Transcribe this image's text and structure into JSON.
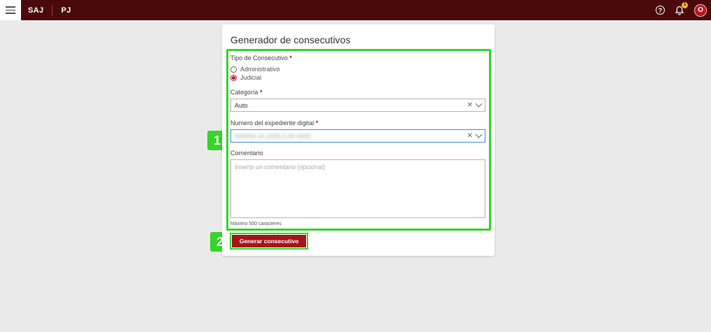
{
  "topbar": {
    "brand_primary": "SAJ",
    "brand_secondary": "PJ",
    "help_icon_glyph": "?",
    "notification_count": "1",
    "avatar_initial": "O"
  },
  "form": {
    "title": "Generador de consecutivos",
    "tipo": {
      "label": "Tipo de Consecutivo",
      "options": [
        "Administrativo",
        "Judicial"
      ],
      "selected": "Judicial"
    },
    "categoria": {
      "label": "Categoría",
      "value": "Auto"
    },
    "expediente": {
      "label": "Numero del expediente digital",
      "value": "000000-15.2025.0.00.0003"
    },
    "comentario": {
      "label": "Comentario",
      "placeholder": "Inserte un comentario (opcional)",
      "helper": "Máximo 500 caracteres"
    },
    "required_mark": "*",
    "submit_label": "Generar consecutivo"
  },
  "annotations": {
    "step1": "1",
    "step2": "2",
    "highlight_color": "#35d52a"
  },
  "colors": {
    "topbar_bg": "#4a0a0c",
    "primary": "#a3141b",
    "page_bg": "#ebeaeb"
  }
}
